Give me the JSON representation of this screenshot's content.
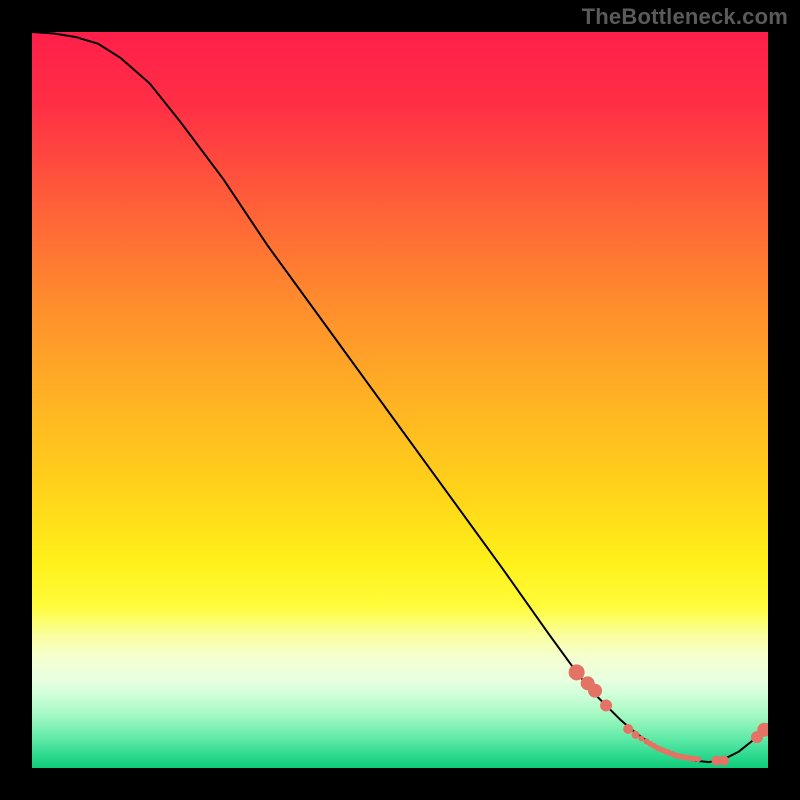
{
  "watermark": "TheBottleneck.com",
  "colors": {
    "marker": "#e47366",
    "line": "#000000"
  },
  "chart_data": {
    "type": "line",
    "title": "",
    "xlabel": "",
    "ylabel": "",
    "xlim": [
      0,
      100
    ],
    "ylim": [
      0,
      100
    ],
    "grid": false,
    "line": {
      "x": [
        0,
        3,
        6,
        9,
        12,
        16,
        20,
        26,
        32,
        40,
        48,
        56,
        64,
        70,
        74,
        76,
        78,
        80,
        82,
        84,
        86,
        88,
        90,
        92,
        94,
        96,
        98,
        100
      ],
      "y": [
        100,
        99.8,
        99.3,
        98.4,
        96.5,
        93,
        88,
        80,
        71,
        60,
        49,
        38,
        27,
        18.5,
        13,
        10.5,
        8.5,
        6.5,
        4.8,
        3.4,
        2.3,
        1.5,
        1,
        0.8,
        1.2,
        2.2,
        3.8,
        6
      ]
    },
    "markers": {
      "x": [
        74,
        75.5,
        76.5,
        78,
        81,
        82,
        82.8,
        83.5,
        84,
        84.5,
        85,
        85.5,
        86,
        86.5,
        87,
        87.5,
        88,
        88.5,
        89,
        89.5,
        90,
        90.5,
        93,
        94,
        98.5,
        99.5
      ],
      "y": [
        13,
        11.5,
        10.5,
        8.5,
        5.3,
        4.5,
        4,
        3.6,
        3.3,
        3.0,
        2.7,
        2.5,
        2.3,
        2.1,
        1.9,
        1.7,
        1.6,
        1.5,
        1.4,
        1.3,
        1.25,
        1.2,
        1.0,
        1.0,
        4.2,
        5.2
      ],
      "sizes": [
        8,
        7,
        7,
        6,
        5,
        4,
        3,
        3,
        3,
        3,
        3,
        3,
        3,
        3,
        3,
        3,
        3,
        3,
        3,
        3,
        3,
        3,
        5,
        5,
        6,
        7
      ]
    },
    "gradient_stops": [
      {
        "offset": 0.0,
        "color": "#ff1f4a"
      },
      {
        "offset": 0.1,
        "color": "#ff2f45"
      },
      {
        "offset": 0.22,
        "color": "#ff5a3a"
      },
      {
        "offset": 0.36,
        "color": "#ff8a2e"
      },
      {
        "offset": 0.5,
        "color": "#ffb223"
      },
      {
        "offset": 0.62,
        "color": "#ffd21a"
      },
      {
        "offset": 0.72,
        "color": "#fff01a"
      },
      {
        "offset": 0.78,
        "color": "#fffc3a"
      },
      {
        "offset": 0.82,
        "color": "#faffa0"
      },
      {
        "offset": 0.85,
        "color": "#f5ffd0"
      },
      {
        "offset": 0.88,
        "color": "#e8ffe0"
      },
      {
        "offset": 0.9,
        "color": "#d0ffd8"
      },
      {
        "offset": 0.93,
        "color": "#a0f8c0"
      },
      {
        "offset": 0.96,
        "color": "#60eaa8"
      },
      {
        "offset": 0.985,
        "color": "#28d88c"
      },
      {
        "offset": 1.0,
        "color": "#0ecd7a"
      }
    ]
  }
}
